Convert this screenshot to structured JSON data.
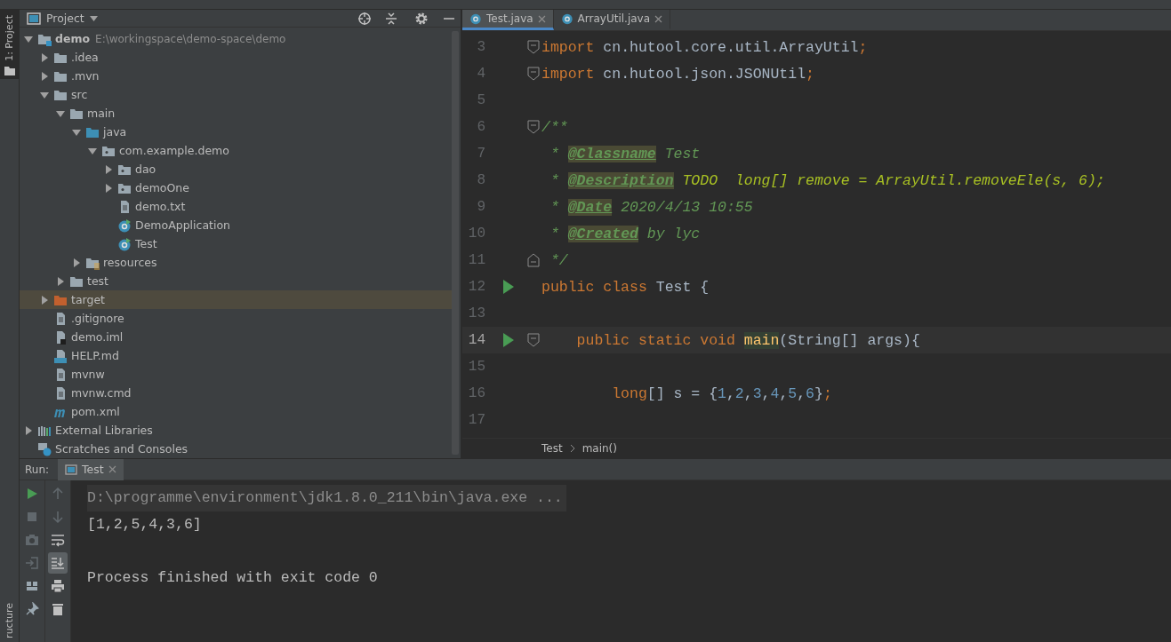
{
  "side_stripe": {
    "top_tab": {
      "label": "1: Project",
      "selected": true
    },
    "bottom_tab": {
      "label": "ructure"
    }
  },
  "project_panel": {
    "title": "Project",
    "tree": [
      {
        "label": "demo",
        "path": "E:\\workingspace\\demo-space\\demo",
        "kind": "module",
        "expanded": true,
        "selected": false,
        "children": [
          {
            "label": ".idea",
            "kind": "folder",
            "expanded": false,
            "selected": false
          },
          {
            "label": ".mvn",
            "kind": "folder",
            "expanded": false,
            "selected": false
          },
          {
            "label": "src",
            "kind": "folder",
            "expanded": true,
            "selected": false,
            "children": [
              {
                "label": "main",
                "kind": "folder",
                "expanded": true,
                "selected": false,
                "children": [
                  {
                    "label": "java",
                    "kind": "source",
                    "expanded": true,
                    "selected": false,
                    "children": [
                      {
                        "label": "com.example.demo",
                        "kind": "package",
                        "expanded": true,
                        "selected": false,
                        "children": [
                          {
                            "label": "dao",
                            "kind": "package",
                            "expanded": false,
                            "selected": false
                          },
                          {
                            "label": "demoOne",
                            "kind": "package",
                            "expanded": false,
                            "selected": false
                          },
                          {
                            "label": "demo.txt",
                            "kind": "file",
                            "selected": false
                          },
                          {
                            "label": "DemoApplication",
                            "kind": "class",
                            "selected": false
                          },
                          {
                            "label": "Test",
                            "kind": "class",
                            "selected": false
                          }
                        ]
                      }
                    ]
                  },
                  {
                    "label": "resources",
                    "kind": "resources",
                    "expanded": false,
                    "selected": false
                  }
                ]
              },
              {
                "label": "test",
                "kind": "folder",
                "expanded": false,
                "selected": false
              }
            ]
          },
          {
            "label": "target",
            "kind": "excluded",
            "expanded": false,
            "selected": true
          },
          {
            "label": ".gitignore",
            "kind": "file",
            "selected": false
          },
          {
            "label": "demo.iml",
            "kind": "iml",
            "selected": false
          },
          {
            "label": "HELP.md",
            "kind": "markdown",
            "selected": false
          },
          {
            "label": "mvnw",
            "kind": "file",
            "selected": false
          },
          {
            "label": "mvnw.cmd",
            "kind": "file",
            "selected": false
          },
          {
            "label": "pom.xml",
            "kind": "maven",
            "selected": false
          }
        ]
      },
      {
        "label": "External Libraries",
        "kind": "libraries",
        "expanded": false,
        "selected": false
      },
      {
        "label": "Scratches and Consoles",
        "kind": "scratches",
        "selected": false
      }
    ]
  },
  "editor": {
    "tabs": [
      {
        "label": "Test.java",
        "selected": true
      },
      {
        "label": "ArrayUtil.java",
        "selected": false
      }
    ],
    "lines": [
      {
        "number": "3",
        "kind": "fold-open",
        "run": false,
        "current": false,
        "tokens": [
          {
            "kind": "keyword",
            "text": "import"
          },
          {
            "kind": "plain",
            "text": " cn.hutool.core.util.ArrayUtil"
          },
          {
            "kind": "keyword",
            "text": ";"
          }
        ]
      },
      {
        "number": "4",
        "kind": "fold-open",
        "run": false,
        "current": false,
        "tokens": [
          {
            "kind": "keyword",
            "text": "import"
          },
          {
            "kind": "plain",
            "text": " cn.hutool.json.JSONUtil"
          },
          {
            "kind": "keyword",
            "text": ";"
          }
        ]
      },
      {
        "number": "5",
        "kind": "plain",
        "run": false,
        "current": false
      },
      {
        "number": "6",
        "kind": "fold-open",
        "run": false,
        "current": false,
        "tokens": [
          {
            "kind": "comment",
            "text": "/**"
          }
        ]
      },
      {
        "number": "7",
        "kind": "plain",
        "run": false,
        "current": false,
        "tokens": [
          {
            "kind": "comment",
            "text": " * "
          },
          {
            "kind": "tag",
            "text": "@Classname"
          },
          {
            "kind": "comment",
            "text": " Test"
          }
        ]
      },
      {
        "number": "8",
        "kind": "plain",
        "run": false,
        "current": false,
        "tokens": [
          {
            "kind": "comment",
            "text": " * "
          },
          {
            "kind": "tag",
            "text": "@Description"
          },
          {
            "kind": "todo",
            "text": " TODO  long[] remove = ArrayUtil.removeEle(s, 6);"
          }
        ]
      },
      {
        "number": "9",
        "kind": "plain",
        "run": false,
        "current": false,
        "tokens": [
          {
            "kind": "comment",
            "text": " * "
          },
          {
            "kind": "tag",
            "text": "@Date"
          },
          {
            "kind": "comment",
            "text": " 2020/4/13 10:55"
          }
        ]
      },
      {
        "number": "10",
        "kind": "plain",
        "run": false,
        "current": false,
        "tokens": [
          {
            "kind": "comment",
            "text": " * "
          },
          {
            "kind": "tag",
            "text": "@Created"
          },
          {
            "kind": "comment",
            "text": " by lyc"
          }
        ]
      },
      {
        "number": "11",
        "kind": "fold-close",
        "run": false,
        "current": false,
        "tokens": [
          {
            "kind": "comment",
            "text": " */"
          }
        ]
      },
      {
        "number": "12",
        "kind": "plain",
        "run": true,
        "current": false,
        "tokens": [
          {
            "kind": "keyword",
            "text": "public class "
          },
          {
            "kind": "plain",
            "text": "Test {"
          }
        ]
      },
      {
        "number": "13",
        "kind": "plain",
        "run": false,
        "current": false
      },
      {
        "number": "14",
        "kind": "fold-open",
        "run": true,
        "current": true,
        "tokens": [
          {
            "kind": "keyword",
            "text": "    public static void "
          },
          {
            "kind": "method",
            "text": "main"
          },
          {
            "kind": "plain",
            "text": "(String[] args){"
          }
        ]
      },
      {
        "number": "15",
        "kind": "plain",
        "run": false,
        "current": false
      },
      {
        "number": "16",
        "kind": "plain",
        "run": false,
        "current": false,
        "tokens": [
          {
            "kind": "keyword",
            "text": "        long"
          },
          {
            "kind": "plain",
            "text": "[] s = {"
          },
          {
            "kind": "number",
            "text": "1"
          },
          {
            "kind": "plain",
            "text": ","
          },
          {
            "kind": "number",
            "text": "2"
          },
          {
            "kind": "plain",
            "text": ","
          },
          {
            "kind": "number",
            "text": "3"
          },
          {
            "kind": "plain",
            "text": ","
          },
          {
            "kind": "number",
            "text": "4"
          },
          {
            "kind": "plain",
            "text": ","
          },
          {
            "kind": "number",
            "text": "5"
          },
          {
            "kind": "plain",
            "text": ","
          },
          {
            "kind": "number",
            "text": "6"
          },
          {
            "kind": "plain",
            "text": "}"
          },
          {
            "kind": "keyword",
            "text": ";"
          }
        ]
      },
      {
        "number": "17",
        "kind": "plain",
        "run": false,
        "current": false
      }
    ],
    "breadcrumbs": [
      "Test",
      "main()"
    ]
  },
  "run_panel": {
    "label": "Run:",
    "tabs": [
      {
        "label": "Test",
        "selected": true
      }
    ],
    "toolbar_left": [
      {
        "kind": "run",
        "disabled": false
      },
      {
        "kind": "stop",
        "disabled": true
      },
      {
        "kind": "camera",
        "disabled": true
      },
      {
        "kind": "enter",
        "disabled": true
      },
      {
        "kind": "layout",
        "disabled": false
      },
      {
        "kind": "pin",
        "disabled": false
      }
    ],
    "toolbar_right": [
      {
        "kind": "up",
        "disabled": true,
        "on": false
      },
      {
        "kind": "down",
        "disabled": true,
        "on": false
      },
      {
        "kind": "wrap",
        "disabled": false,
        "on": false
      },
      {
        "kind": "scroll-end",
        "disabled": false,
        "on": true
      },
      {
        "kind": "print",
        "disabled": false,
        "on": false
      },
      {
        "kind": "trash",
        "disabled": false,
        "on": false
      }
    ],
    "console": [
      {
        "kind": "command",
        "text": "D:\\programme\\environment\\jdk1.8.0_211\\bin\\java.exe ..."
      },
      {
        "kind": "output",
        "text": "[1,2,5,4,3,6]"
      },
      {
        "kind": "exit",
        "text": "Process finished with exit code 0"
      }
    ]
  }
}
